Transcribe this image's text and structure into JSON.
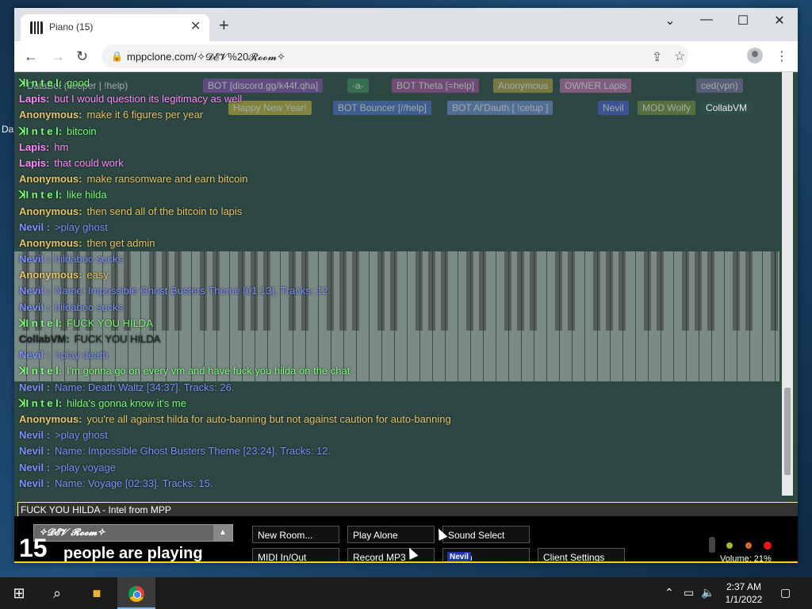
{
  "desktop": {
    "label": "Da"
  },
  "browser": {
    "tab_title": "Piano (15)",
    "tab_close": "✕",
    "new_tab": "+",
    "url": "mppclone.com/✧𝓓𝓔𝓥%20𝓡𝓸𝓸𝓶✧",
    "window_controls": {
      "dropdown": "⌄",
      "minimize": "—",
      "maximize": "☐",
      "close": "✕"
    }
  },
  "userbar": {
    "tags": [
      {
        "label": "DataBot (keeper | !help)",
        "color": "#3a8ea0"
      },
      {
        "label": "BOT [discord.gg/k44f.qha]",
        "color": "#8a4fb5"
      },
      {
        "label": "-a-",
        "color": "#3f8f5c"
      },
      {
        "label": "BOT Theta [=help]",
        "color": "#a84fa0"
      },
      {
        "label": "Anonymous",
        "color": "#b8a24a"
      },
      {
        "label": "OWNER Lapis",
        "color": "#c46fb0"
      },
      {
        "label": "ced(vpn)",
        "color": "#7a6fa0"
      },
      {
        "label": "Happy New Year!",
        "color": "#c9b538"
      },
      {
        "label": "BOT Bouncer [//help]",
        "color": "#4f6fd0"
      },
      {
        "label": "BOT Al'Dauth [ !cetup ]",
        "color": "#6f8fd8"
      },
      {
        "label": "Nevil",
        "color": "#4a5fd8"
      },
      {
        "label": "MOD Wolfy",
        "color": "#7a8f3a"
      },
      {
        "label": "CollabVM",
        "color": "#2f4f4a"
      }
    ]
  },
  "chat": {
    "messages": [
      {
        "name": "ꓘI n t e l:",
        "text": "good",
        "color": "#7bff7b"
      },
      {
        "name": "Lapis:",
        "text": "but I would question its legitimacy as well",
        "color": "#ff8cff"
      },
      {
        "name": "Anonymous:",
        "text": "make it 6 figures per year",
        "color": "#e6c66e"
      },
      {
        "name": "ꓘI n t e l:",
        "text": "bitcoin",
        "color": "#7bff7b"
      },
      {
        "name": "Lapis:",
        "text": "hm",
        "color": "#ff8cff"
      },
      {
        "name": "Lapis:",
        "text": "that could work",
        "color": "#ff8cff"
      },
      {
        "name": "Anonymous:",
        "text": "make ransomware and earn bitcoin",
        "color": "#e6c66e"
      },
      {
        "name": "ꓘI n t e l:",
        "text": "like hilda",
        "color": "#7bff7b"
      },
      {
        "name": "Anonymous:",
        "text": "then send all of the bitcoin to lapis",
        "color": "#e6c66e"
      },
      {
        "name": "Nevil :",
        "text": ">play ghost",
        "color": "#7f93ff"
      },
      {
        "name": "Anonymous:",
        "text": "then get admin",
        "color": "#e6c66e"
      },
      {
        "name": "Nevil :",
        "text": "hildaboo sucks",
        "color": "#7f93ff"
      },
      {
        "name": "Anonymous:",
        "text": "easy",
        "color": "#e6c66e"
      },
      {
        "name": "Nevil :",
        "text": "Name: Impossible Ghost Busters Theme [01:13]. Tracks: 12.",
        "color": "#7f93ff"
      },
      {
        "name": "Nevil :",
        "text": "hildaboo sucks",
        "color": "#7f93ff"
      },
      {
        "name": "ꓘI n t e l:",
        "text": "FUCK YOU HILDA",
        "color": "#7bff7b"
      },
      {
        "name": "CollabVM:",
        "text": "FUCK YOU HILDA",
        "color": "#1a2a28"
      },
      {
        "name": "Nevil :",
        "text": ">play death",
        "color": "#7f93ff"
      },
      {
        "name": "ꓘI n t e l:",
        "text": "I'm gonna go on every vm and have fuck you hilda on the chat",
        "color": "#7bff7b"
      },
      {
        "name": "Nevil :",
        "text": "Name: Death Waltz [34:37]. Tracks: 26.",
        "color": "#7f93ff"
      },
      {
        "name": "ꓘI n t e l:",
        "text": "hilda's gonna know it's me",
        "color": "#7bff7b"
      },
      {
        "name": "Anonymous:",
        "text": "you're all against hilda for auto-banning but not against caution for auto-banning",
        "color": "#e6c66e"
      },
      {
        "name": "Nevil :",
        "text": ">play ghost",
        "color": "#7f93ff"
      },
      {
        "name": "Nevil :",
        "text": "Name: Impossible Ghost Busters Theme [23:24]. Tracks: 12.",
        "color": "#7f93ff"
      },
      {
        "name": "Nevil :",
        "text": ">play voyage",
        "color": "#7f93ff"
      },
      {
        "name": "Nevil :",
        "text": "Name: Voyage [02:33]. Tracks: 15.",
        "color": "#7f93ff"
      }
    ],
    "input_value": "FUCK YOU HILDA - Intel from MPP"
  },
  "controls": {
    "room_name": "✧𝓓𝓔𝓥 𝓡𝓸𝓸𝓶✧",
    "room_arrow": "▲",
    "player_count": "15",
    "people_label": "people are playing",
    "buttons": {
      "new_room": "New Room...",
      "play_alone": "Play Alone",
      "sound_select": "Sound Select",
      "midi": "MIDI In/Out",
      "record": "Record MP3",
      "synth": "Synth",
      "client_settings": "Client Settings"
    },
    "synth_overlay": "Nevil",
    "volume": "Volume: 21%"
  },
  "taskbar": {
    "time": "2:37 AM",
    "date": "1/1/2022"
  }
}
